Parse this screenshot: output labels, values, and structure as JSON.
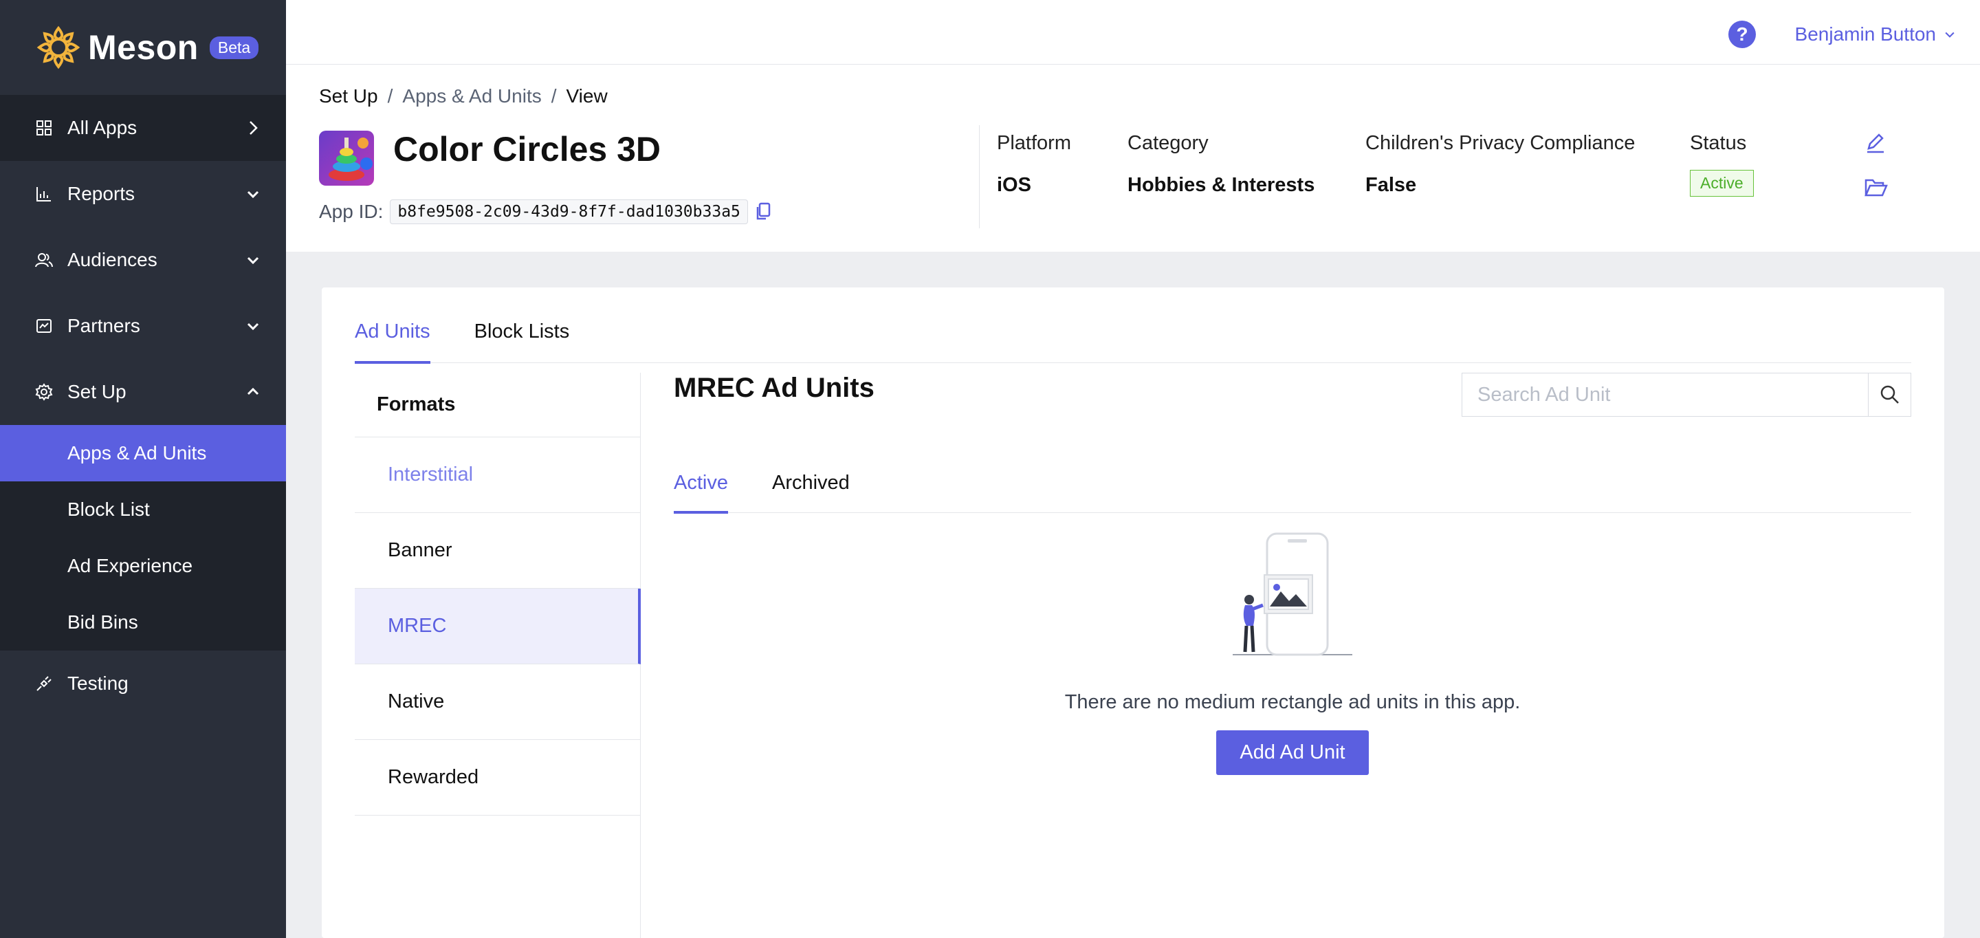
{
  "brand": {
    "name": "Meson",
    "badge": "Beta"
  },
  "nav": {
    "all_apps": "All Apps",
    "reports": "Reports",
    "audiences": "Audiences",
    "partners": "Partners",
    "setup": "Set Up",
    "setup_children": [
      "Apps & Ad Units",
      "Block List",
      "Ad Experience",
      "Bid Bins"
    ],
    "testing": "Testing"
  },
  "topbar": {
    "help": "?",
    "user": "Benjamin Button"
  },
  "breadcrumb": [
    "Set Up",
    "Apps & Ad Units",
    "View"
  ],
  "app": {
    "title": "Color Circles 3D",
    "id_label": "App ID:",
    "id_value": "b8fe9508-2c09-43d9-8f7f-dad1030b33a5",
    "platform_label": "Platform",
    "platform": "iOS",
    "category_label": "Category",
    "category": "Hobbies & Interests",
    "privacy_label": "Children's Privacy Compliance",
    "privacy": "False",
    "status_label": "Status",
    "status": "Active"
  },
  "tabs": [
    "Ad Units",
    "Block Lists"
  ],
  "formats": {
    "header": "Formats",
    "items": [
      "Interstitial",
      "Banner",
      "MREC",
      "Native",
      "Rewarded"
    ]
  },
  "content": {
    "title": "MREC Ad Units",
    "search_placeholder": "Search Ad Unit",
    "subtabs": [
      "Active",
      "Archived"
    ],
    "empty_text": "There are no medium rectangle ad units in this app.",
    "add_button": "Add Ad Unit"
  },
  "colors": {
    "accent": "#5b5fe0",
    "sidebar": "#2a2f3a",
    "success": "#4cae2a"
  }
}
